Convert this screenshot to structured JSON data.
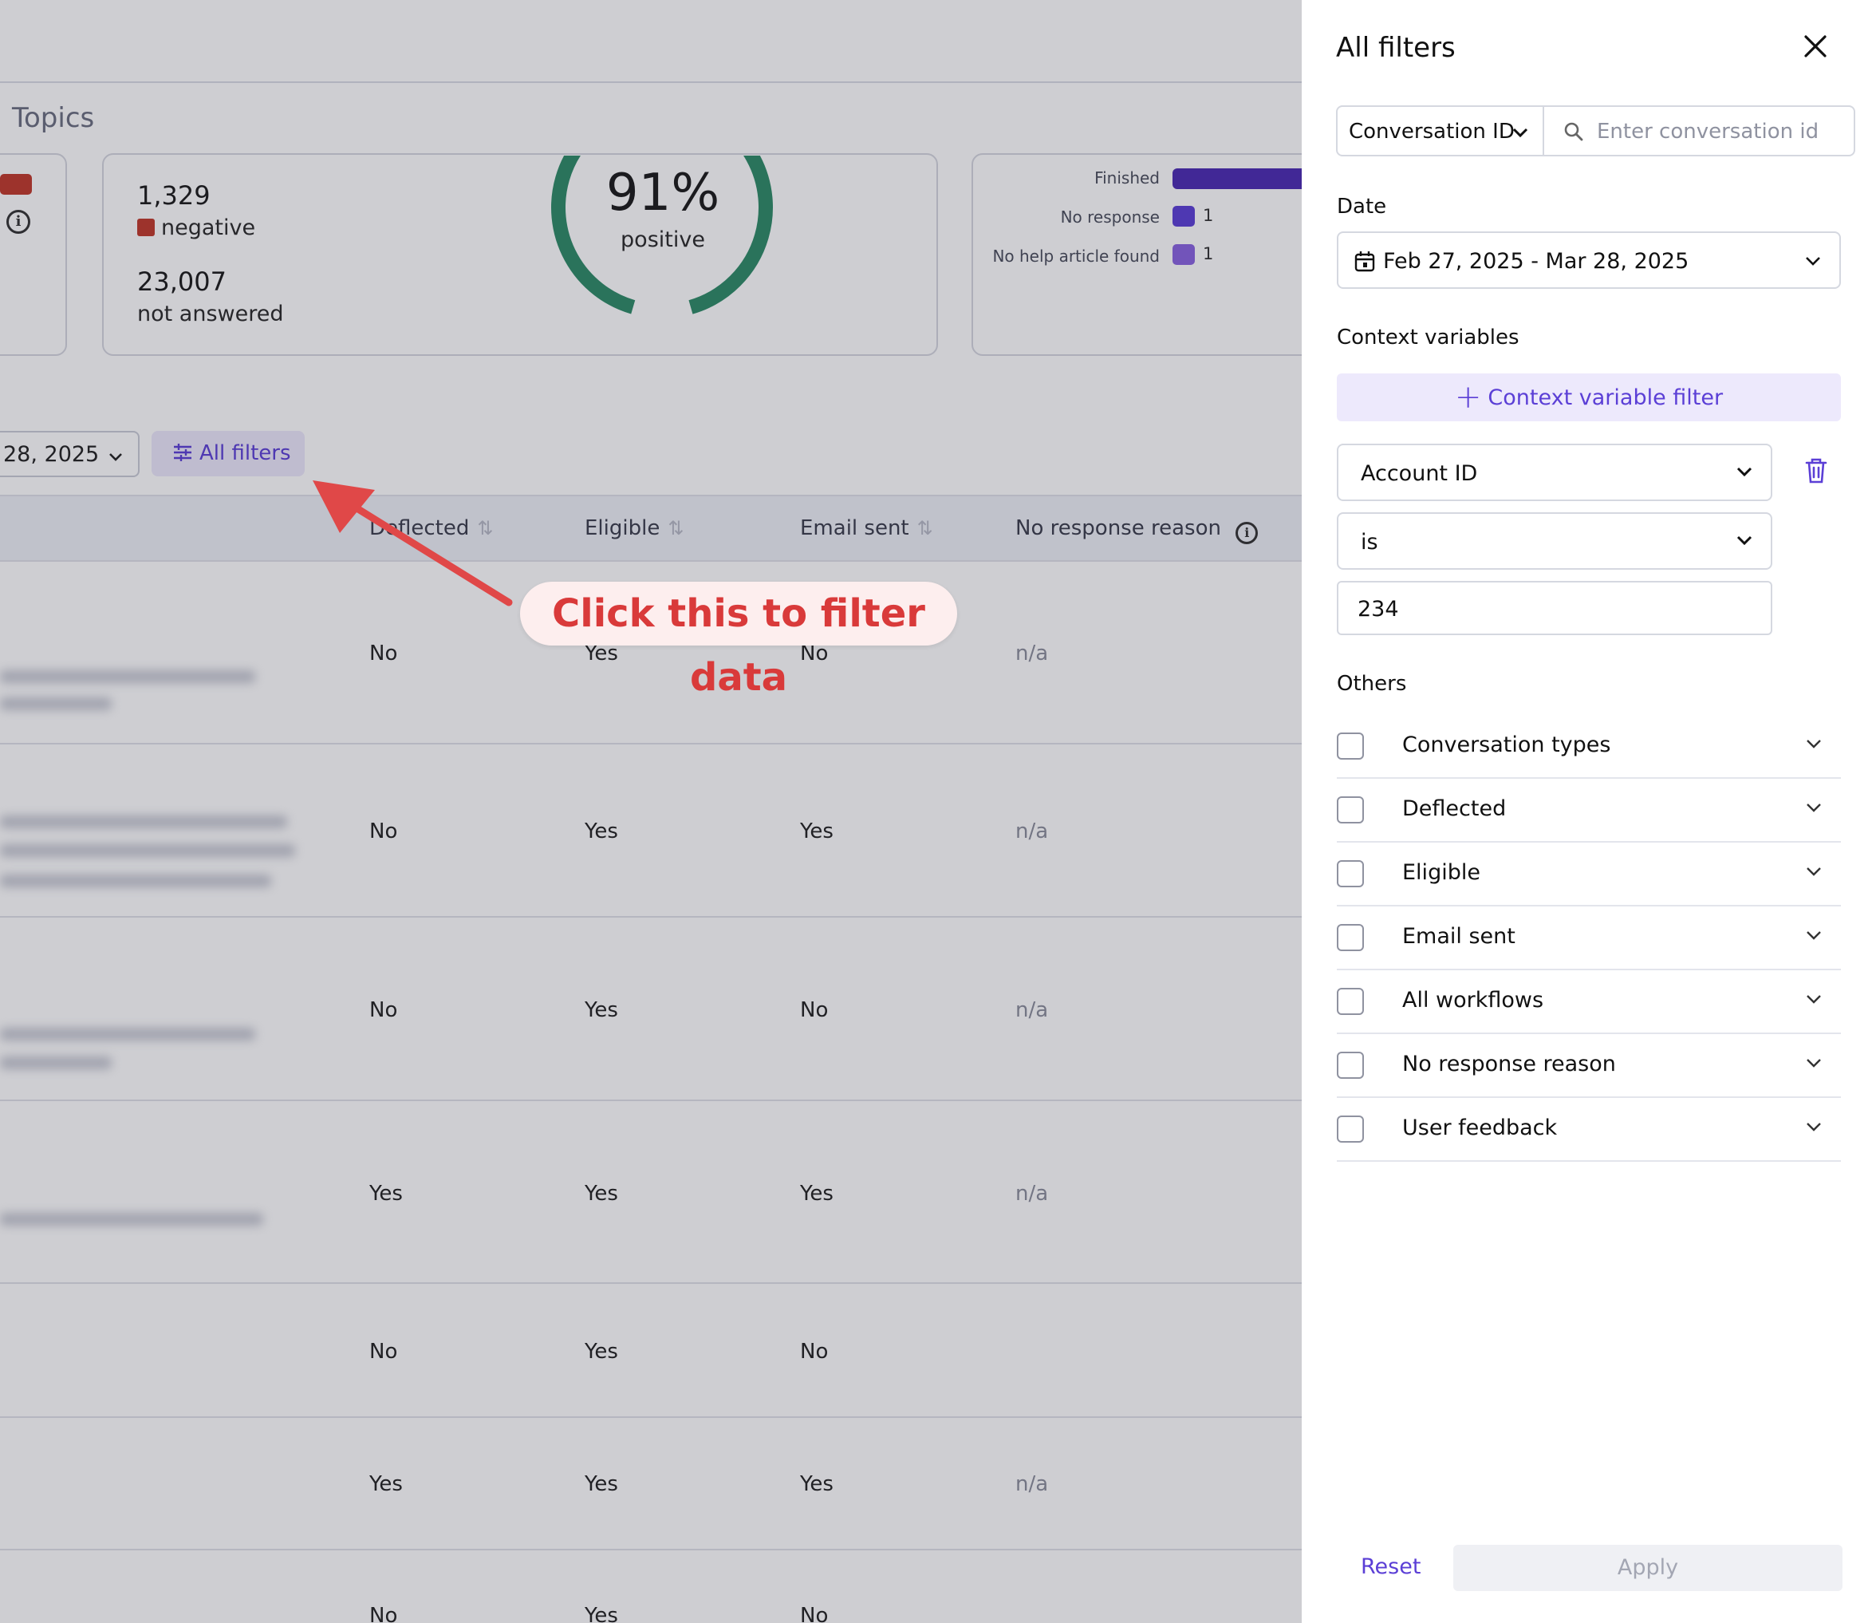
{
  "background": {
    "section_title": "Topics",
    "stats": {
      "negative_count": "1,329",
      "negative_label": "negative",
      "not_answered_count": "23,007",
      "not_answered_label": "not answered"
    },
    "donut": {
      "percent": "91%",
      "label": "positive",
      "fraction": 0.91
    },
    "status_bars": [
      {
        "label": "Finished",
        "count": "",
        "color": "#4b2bb3"
      },
      {
        "label": "No response",
        "count": "1",
        "color": "#5b3fd6"
      },
      {
        "label": "No help article found",
        "count": "1",
        "color": "#8a63e0"
      }
    ],
    "date_chip": "28, 2025",
    "all_filters_label": "All filters",
    "table": {
      "headers": [
        "Deflected",
        "Eligible",
        "Email sent",
        "No response reason"
      ],
      "rows": [
        [
          "No",
          "Yes",
          "No",
          "n/a"
        ],
        [
          "No",
          "Yes",
          "Yes",
          "n/a"
        ],
        [
          "No",
          "Yes",
          "No",
          "n/a"
        ],
        [
          "Yes",
          "Yes",
          "Yes",
          "n/a"
        ],
        [
          "No",
          "Yes",
          "No",
          ""
        ],
        [
          "Yes",
          "Yes",
          "Yes",
          "n/a"
        ],
        [
          "No",
          "Yes",
          "No",
          ""
        ]
      ]
    },
    "callout": "Click this to filter data"
  },
  "panel": {
    "title": "All filters",
    "search_type": "Conversation ID",
    "search_placeholder": "Enter conversation id",
    "date_label": "Date",
    "date_range": "Feb 27, 2025 - Mar 28, 2025",
    "context_label": "Context variables",
    "context_add": "Context variable filter",
    "context_field": "Account ID",
    "context_operator": "is",
    "context_value": "234",
    "others_label": "Others",
    "others": [
      "Conversation types",
      "Deflected",
      "Eligible",
      "Email sent",
      "All workflows",
      "No response reason",
      "User feedback"
    ],
    "reset": "Reset",
    "apply": "Apply"
  },
  "colors": {
    "accent": "#5b3fd6",
    "negative": "#c0392b",
    "donut": "#2e8b67",
    "callout": "#d93a3a"
  }
}
